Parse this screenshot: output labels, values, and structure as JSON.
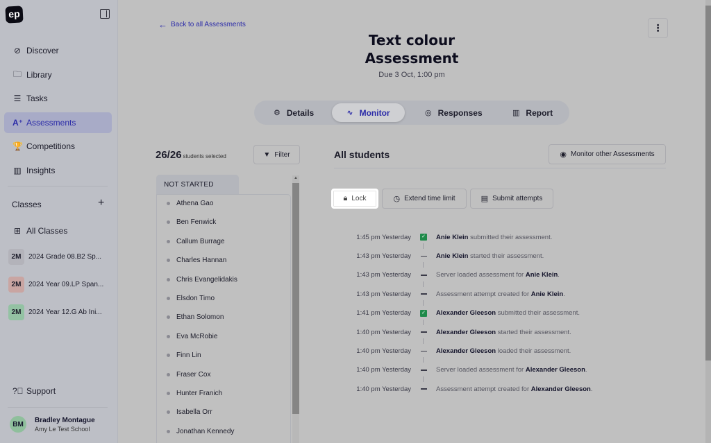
{
  "sidebar": {
    "logo": "ep",
    "nav": [
      {
        "label": "Discover",
        "icon": "compass-icon",
        "glyph": "⊘"
      },
      {
        "label": "Library",
        "icon": "folder-icon",
        "glyph": "🗀"
      },
      {
        "label": "Tasks",
        "icon": "tasks-icon",
        "glyph": "☰"
      },
      {
        "label": "Assessments",
        "icon": "assessments-icon",
        "glyph": "A⁺"
      },
      {
        "label": "Competitions",
        "icon": "trophy-icon",
        "glyph": "🏆"
      },
      {
        "label": "Insights",
        "icon": "bar-chart-icon",
        "glyph": "▥"
      }
    ],
    "classes_heading": "Classes",
    "add_class": "+",
    "all_classes": "All Classes",
    "classes": [
      {
        "badge": "2M",
        "name": "2024 Grade 08.B2 Sp...",
        "color": "#b3b3ba"
      },
      {
        "badge": "2M",
        "name": "2024 Year 09.LP Span...",
        "color": "#c9a5a2"
      },
      {
        "badge": "2M",
        "name": "2024 Year 12.G Ab Ini...",
        "color": "#93c2a3"
      }
    ],
    "support": "Support",
    "user": {
      "initials": "BM",
      "name": "Bradley Montague",
      "school": "Amy Le Test School"
    }
  },
  "header": {
    "back_label": "Back to all Assessments",
    "title_line1": "Text colour",
    "title_line2": "Assessment",
    "due": "Due 3 Oct, 1:00 pm",
    "more_glyph": "⋮"
  },
  "tabs": [
    {
      "label": "Details",
      "glyph": "⚙"
    },
    {
      "label": "Monitor",
      "glyph": "∿"
    },
    {
      "label": "Responses",
      "glyph": "◎"
    },
    {
      "label": "Report",
      "glyph": "▥"
    }
  ],
  "students": {
    "count": "26/26",
    "count_label": "students selected",
    "filter_label": "Filter",
    "group_label": "NOT STARTED",
    "names": [
      "Athena Gao",
      "Ben Fenwick",
      "Callum Burrage",
      "Charles Hannan",
      "Chris Evangelidakis",
      "Elsdon Timo",
      "Ethan Solomon",
      "Eva McRobie",
      "Finn Lin",
      "Fraser Cox",
      "Hunter Franich",
      "Isabella Orr",
      "Jonathan Kennedy"
    ]
  },
  "main": {
    "heading": "All students",
    "monitor_other": "Monitor other Assessments",
    "actions": {
      "lock": "Lock",
      "extend": "Extend time limit",
      "submit": "Submit attempts"
    }
  },
  "events": [
    {
      "time": "1:45 pm Yesterday",
      "type": "check",
      "pre": "",
      "bold": "Anie Klein",
      "post": " submitted their assessment.",
      "bold_first": true
    },
    {
      "time": "1:43 pm Yesterday",
      "type": "dash",
      "pre": "",
      "bold": "Anie Klein",
      "post": " started their assessment.",
      "bold_first": true
    },
    {
      "time": "1:43 pm Yesterday",
      "type": "dash",
      "pre": "Server loaded assessment for ",
      "bold": "Anie Klein",
      "post": ".",
      "bold_first": false
    },
    {
      "time": "1:43 pm Yesterday",
      "type": "dash",
      "pre": "Assessment attempt created for ",
      "bold": "Anie Klein",
      "post": ".",
      "bold_first": false
    },
    {
      "time": "1:41 pm Yesterday",
      "type": "check",
      "pre": "",
      "bold": "Alexander Gleeson",
      "post": " submitted their assessment.",
      "bold_first": true
    },
    {
      "time": "1:40 pm Yesterday",
      "type": "dash",
      "pre": "",
      "bold": "Alexander Gleeson",
      "post": " started their assessment.",
      "bold_first": true
    },
    {
      "time": "1:40 pm Yesterday",
      "type": "dash",
      "pre": "",
      "bold": "Alexander Gleeson",
      "post": " loaded their assessment.",
      "bold_first": true
    },
    {
      "time": "1:40 pm Yesterday",
      "type": "dash",
      "pre": "Server loaded assessment for ",
      "bold": "Alexander Gleeson",
      "post": ".",
      "bold_first": false
    },
    {
      "time": "1:40 pm Yesterday",
      "type": "dash",
      "pre": "Assessment attempt created for ",
      "bold": "Alexander Gleeson",
      "post": ".",
      "bold_first": false
    }
  ]
}
